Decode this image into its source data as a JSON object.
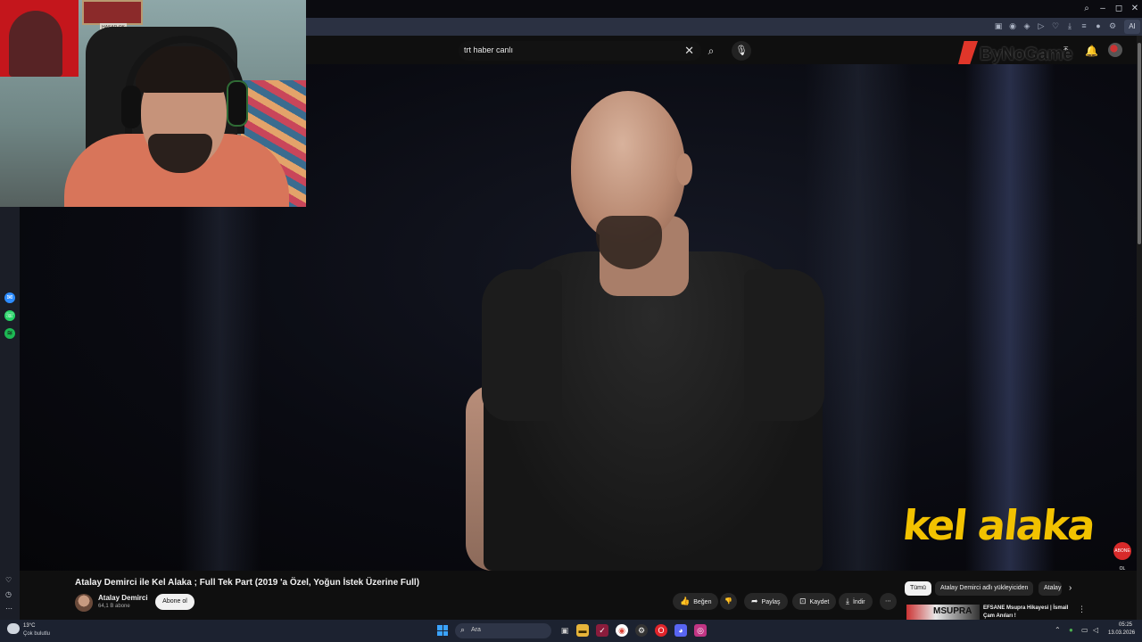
{
  "browser": {
    "window_controls": {
      "search": "⌕",
      "minimize": "–",
      "maximize": "◻",
      "close": "✕"
    },
    "toolbar_right_label": "AI"
  },
  "youtube": {
    "search_value": "trt haber canlı",
    "watermark": "ByNoGame"
  },
  "video": {
    "overlay_logo": "kel alaka",
    "abone_badge": "ABONE OL",
    "title": "Atalay Demirci ile Kel Alaka ; Full Tek Part (2019 'a Özel, Yoğun İstek Üzerine Full)",
    "channel_name": "Atalay Demirci",
    "subscribers": "64,1 B abone",
    "subscribe_label": "Abone ol",
    "actions": {
      "like": "Beğen",
      "share": "Paylaş",
      "save": "Kaydet",
      "download": "İndir",
      "more": "⋯"
    }
  },
  "chips": {
    "all": "Tümü",
    "uploader": "Atalay Demirci adlı yükleyiciden",
    "partial": "Atalay"
  },
  "recommendation": {
    "title": "EFSANE Msupra Hikayesi | İsmail Çam Anıları !",
    "thumb_text": "MSUPRA"
  },
  "webcam": {
    "shelf_text": "HASAR OK"
  },
  "taskbar": {
    "temperature": "13°C",
    "weather": "Çok bulutlu",
    "search_placeholder": "Ara",
    "time": "05:25",
    "date": "13.03.2026"
  },
  "colors": {
    "accent_red": "#e0362a",
    "logo_yellow": "#f2c200",
    "background": "#0f0f0f"
  }
}
